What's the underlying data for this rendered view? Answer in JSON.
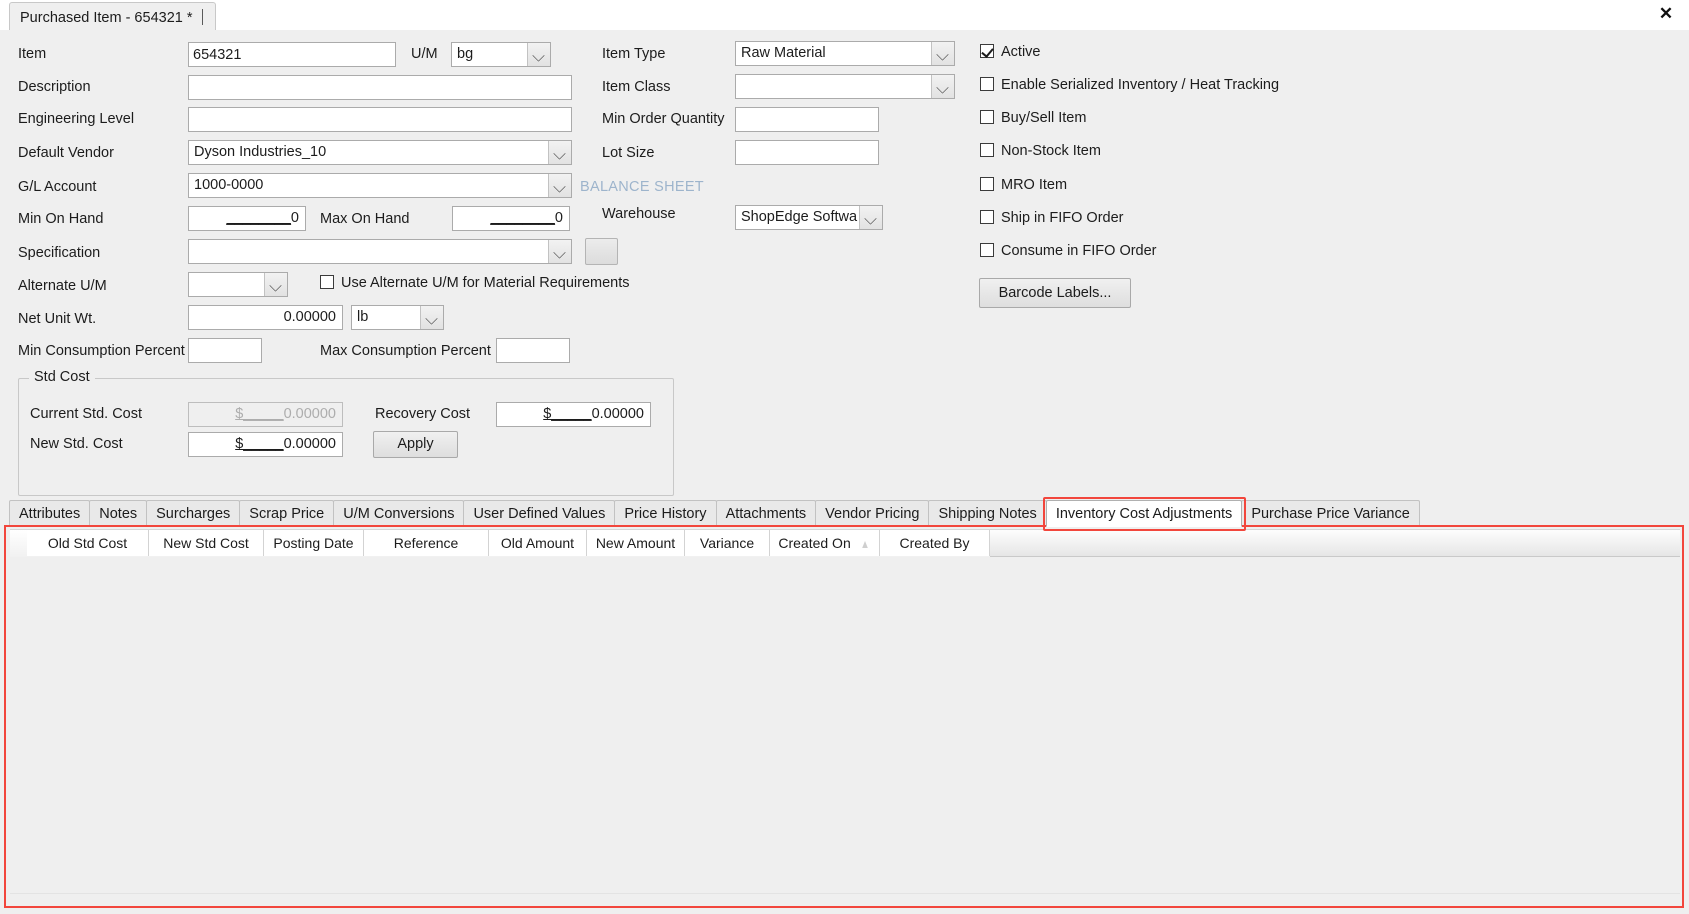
{
  "window": {
    "document_tab_title": "Purchased Item - 654321 *",
    "close_icon": "close-icon"
  },
  "form": {
    "labels": {
      "item": "Item",
      "um": "U/M",
      "description": "Description",
      "engineering_level": "Engineering Level",
      "default_vendor": "Default Vendor",
      "gl_account": "G/L Account",
      "min_on_hand": "Min On Hand",
      "max_on_hand": "Max On Hand",
      "specification": "Specification",
      "alternate_um": "Alternate U/M",
      "net_unit_wt": "Net Unit Wt.",
      "min_consumption_percent": "Min Consumption Percent",
      "max_consumption_percent": "Max Consumption Percent",
      "item_type": "Item Type",
      "item_class": "Item Class",
      "min_order_quantity": "Min Order Quantity",
      "lot_size": "Lot Size",
      "balance_sheet": "BALANCE SHEET",
      "warehouse": "Warehouse"
    },
    "values": {
      "item": "654321",
      "um": "bg",
      "description": "",
      "engineering_level": "",
      "default_vendor": "Dyson Industries_10",
      "gl_account": "1000-0000",
      "min_on_hand_mask": "________",
      "min_on_hand": "0",
      "max_on_hand_mask": "________",
      "max_on_hand": "0",
      "specification": "",
      "alternate_um": "",
      "net_unit_wt": "0.00000",
      "net_unit_wt_um": "lb",
      "min_consumption_percent": "",
      "max_consumption_percent": "",
      "item_type": "Raw Material",
      "item_class": "",
      "min_order_quantity": "",
      "lot_size": "",
      "warehouse": "ShopEdge Software"
    },
    "checkboxes": [
      {
        "name": "active",
        "label": "Active",
        "checked": true
      },
      {
        "name": "serialized",
        "label": "Enable Serialized Inventory / Heat Tracking",
        "checked": false
      },
      {
        "name": "buy-sell-item",
        "label": "Buy/Sell Item",
        "checked": false
      },
      {
        "name": "non-stock-item",
        "label": "Non-Stock Item",
        "checked": false
      },
      {
        "name": "mro-item",
        "label": "MRO Item",
        "checked": false
      },
      {
        "name": "ship-fifo",
        "label": "Ship in FIFO Order",
        "checked": false
      },
      {
        "name": "consume-fifo",
        "label": "Consume in FIFO Order",
        "checked": false
      }
    ],
    "use_alternate_um_checkbox": {
      "label": "Use Alternate U/M for Material Requirements",
      "checked": false
    },
    "barcode_labels_button": "Barcode Labels...",
    "std_cost": {
      "group_title": "Std Cost",
      "current_std_cost_label": "Current Std. Cost",
      "current_std_cost_mask": "$_____",
      "current_std_cost": "0.00000",
      "new_std_cost_label": "New Std. Cost",
      "new_std_cost_mask": "$_____",
      "new_std_cost": "0.00000",
      "recovery_cost_label": "Recovery Cost",
      "recovery_cost_mask": "$_____",
      "recovery_cost": "0.00000",
      "apply_button": "Apply"
    }
  },
  "bottom_tabs": {
    "items": [
      "Attributes",
      "Notes",
      "Surcharges",
      "Scrap Price",
      "U/M Conversions",
      "User Defined Values",
      "Price History",
      "Attachments",
      "Vendor Pricing",
      "Shipping Notes",
      "Inventory Cost Adjustments",
      "Purchase Price Variance"
    ],
    "active_index": 10,
    "highlight_color": "#f2463c"
  },
  "grid": {
    "columns": [
      {
        "label": "Old Std Cost",
        "sort": ""
      },
      {
        "label": "New Std Cost",
        "sort": ""
      },
      {
        "label": "Posting Date",
        "sort": ""
      },
      {
        "label": "Reference",
        "sort": ""
      },
      {
        "label": "Old Amount",
        "sort": ""
      },
      {
        "label": "New Amount",
        "sort": ""
      },
      {
        "label": "Variance",
        "sort": ""
      },
      {
        "label": "Created On",
        "sort": "▲"
      },
      {
        "label": "Created By",
        "sort": ""
      }
    ],
    "rows": []
  }
}
